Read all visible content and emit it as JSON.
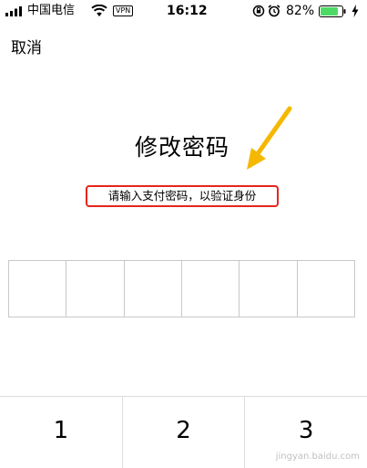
{
  "status_bar": {
    "carrier": "中国电信",
    "vpn": "VPN",
    "time": "16:12",
    "battery_percent": "82%",
    "battery_level": 0.82,
    "battery_color": "#4cd964"
  },
  "nav": {
    "cancel_label": "取消"
  },
  "title": "修改密码",
  "subtitle": "请输入支付密码，以验证身份",
  "colors": {
    "highlight_border": "#e5261d",
    "arrow": "#f5b800"
  },
  "pin_length": 6,
  "keypad": {
    "keys": [
      "1",
      "2",
      "3"
    ]
  },
  "watermark": "jingyan.baidu.com"
}
